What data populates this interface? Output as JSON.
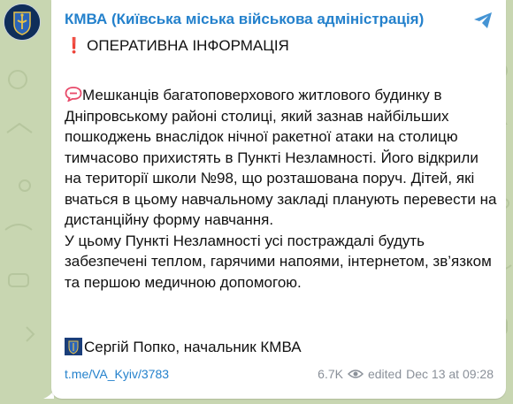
{
  "channel": {
    "name": "КМВА (Київська міська військова адміністрація)"
  },
  "post": {
    "headline_marker": "❗",
    "headline": "ОПЕРАТИВНА ІНФОРМАЦІЯ",
    "paragraphs": [
      "Мешканців багатоповерхового житлового будинку в Дніпровському районі столиці, який зазнав найбільших пошкоджень внаслідок нічної ракетної атаки на столицю тимчасово прихистять в Пункті Незламності. Його відкрили на території школи №98, що розташована поруч. Дітей, які вчаться в цьому навчальному закладі планують перевести на дистанційну форму навчання.",
      "У цьому Пункті Незламності усі постраждалі будуть забезпечені теплом, гарячими напоями, інтернетом, зв’язком та першою медичною допомогою."
    ],
    "signature": "Сергій Попко, начальник КМВА",
    "link": "t.me/VA_Kyiv/3783",
    "views": "6.7K",
    "edited": "edited",
    "timestamp": "Dec 13 at 09:28"
  },
  "icons": {
    "avatar": "kyiv-coat-of-arms-icon",
    "share": "share-arrow-icon",
    "speech": "speech-bubble-icon",
    "views": "eye-icon"
  },
  "colors": {
    "accent": "#2481cc",
    "exclaim": "#e0312f",
    "speech_icon": "#e84a6a",
    "meta": "#8a9099",
    "wallpaper": "#c9d7b3"
  }
}
